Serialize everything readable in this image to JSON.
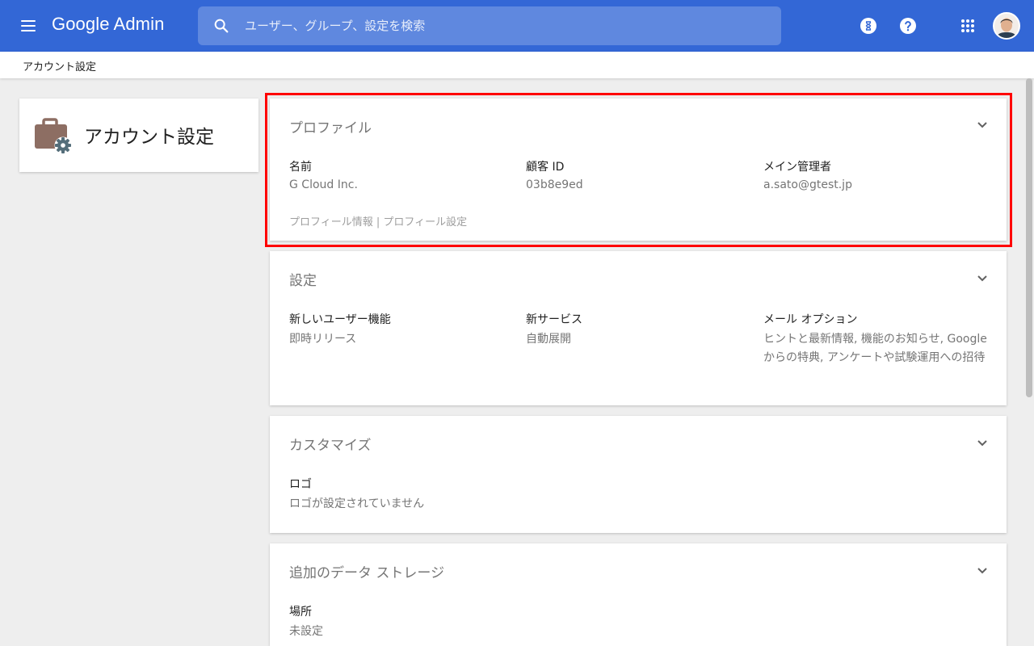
{
  "topbar": {
    "logo": "Google Admin",
    "search_placeholder": "ユーザー、グループ、設定を検索"
  },
  "breadcrumb": "アカウント設定",
  "left_card": {
    "title": "アカウント設定"
  },
  "cards": {
    "profile": {
      "title": "プロファイル",
      "fields": [
        {
          "label": "名前",
          "value": "G Cloud Inc."
        },
        {
          "label": "顧客 ID",
          "value": "03b8e9ed"
        },
        {
          "label": "メイン管理者",
          "value": "a.sato@gtest.jp"
        }
      ],
      "link_info": "プロフィール情報",
      "link_sep": " | ",
      "link_settings": "プロフィール設定"
    },
    "settings": {
      "title": "設定",
      "fields": [
        {
          "label": "新しいユーザー機能",
          "value": "即時リリース"
        },
        {
          "label": "新サービス",
          "value": "自動展開"
        },
        {
          "label": "メール オプション",
          "value": "ヒントと最新情報, 機能のお知らせ, Google からの特典, アンケートや試験運用への招待"
        }
      ]
    },
    "customize": {
      "title": "カスタマイズ",
      "fields": [
        {
          "label": "ロゴ",
          "value": "ロゴが設定されていません"
        }
      ]
    },
    "storage": {
      "title": "追加のデータ ストレージ",
      "fields": [
        {
          "label": "場所",
          "value": "未設定"
        }
      ]
    }
  },
  "colors": {
    "topbar": "#3367d6",
    "highlight": "#ff0000",
    "briefcase": "#8d6e63",
    "gear": "#546e7a"
  }
}
